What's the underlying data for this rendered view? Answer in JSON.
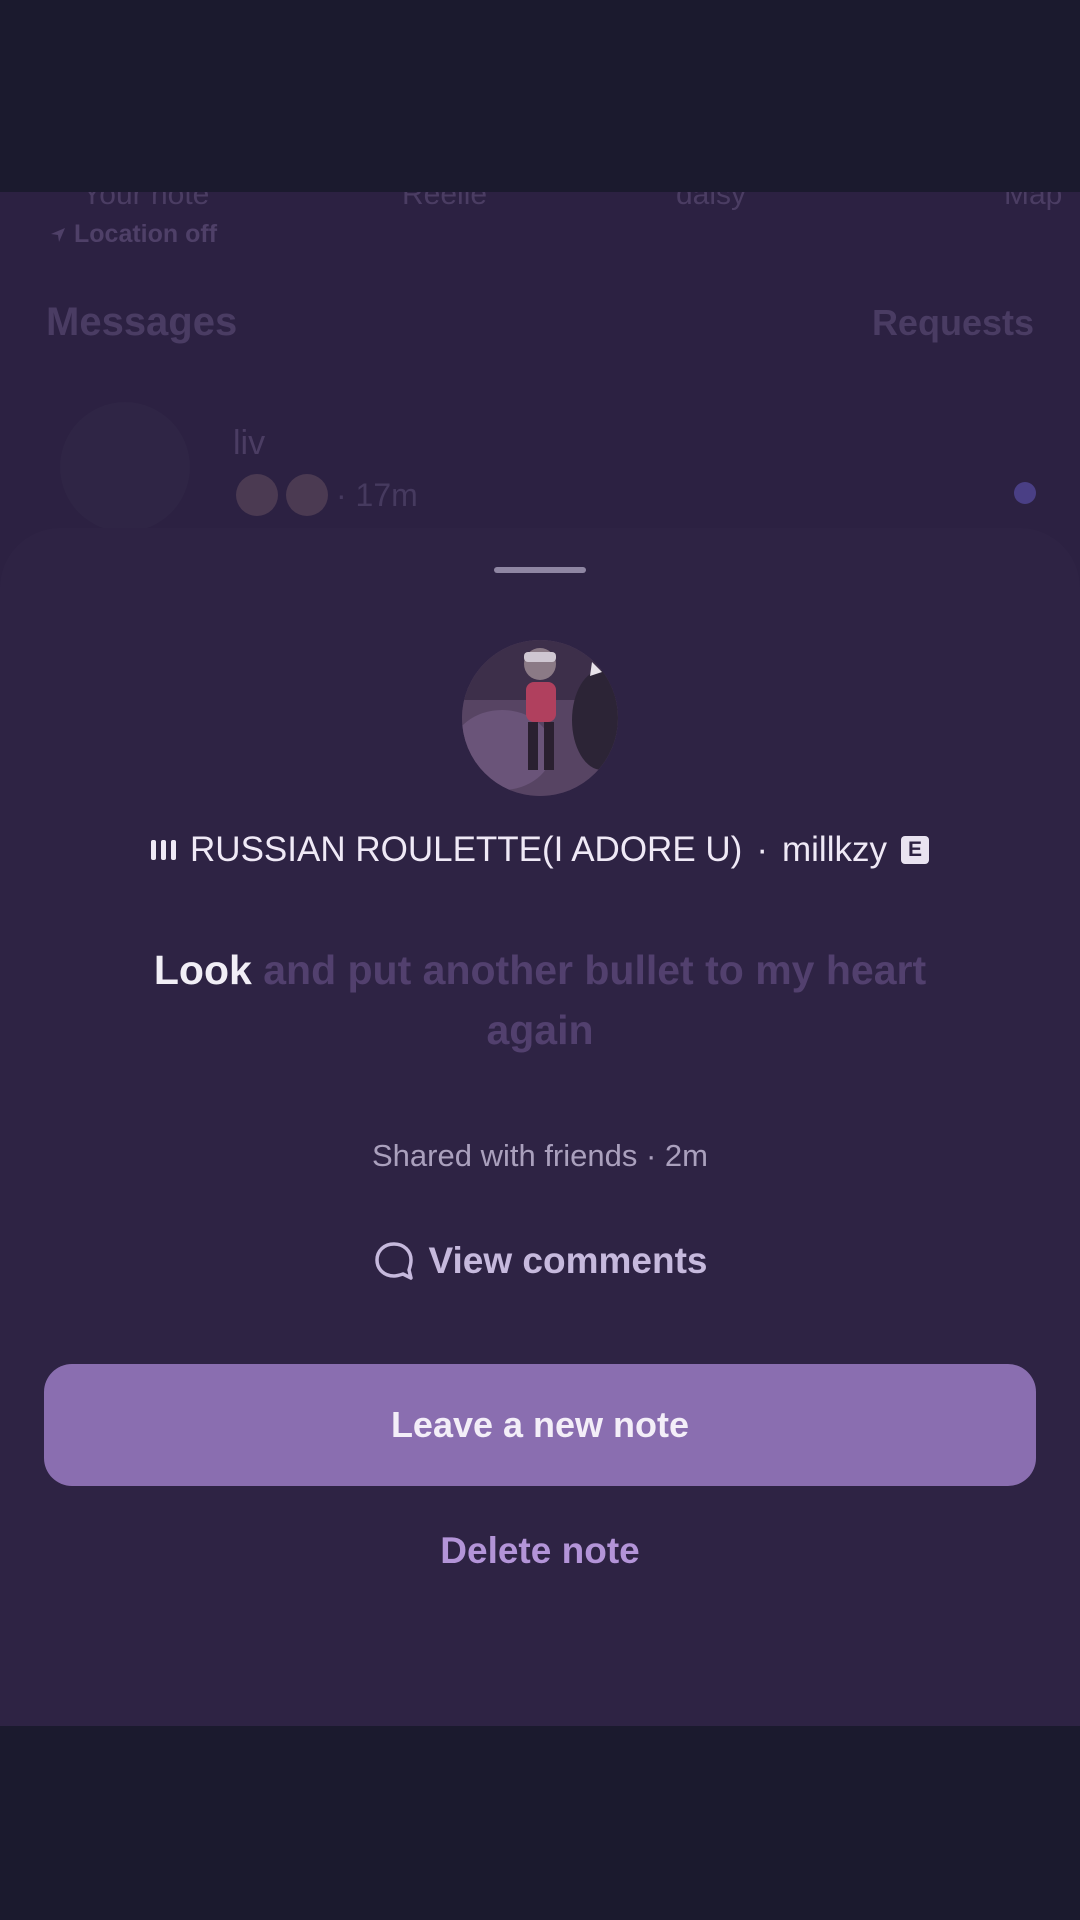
{
  "background": {
    "notes_row": [
      "Your note",
      "Reelle",
      "daisy",
      "Map"
    ],
    "location_text": "Location off",
    "messages_title": "Messages",
    "requests_label": "Requests",
    "chat": {
      "name": "liv",
      "emojis": [
        "neutral-face-emoji",
        "neutral-face-emoji"
      ],
      "time": "· 17m",
      "unread": true
    }
  },
  "sheet": {
    "music": {
      "title": "RUSSIAN ROULETTE(I ADORE U)",
      "separator": "·",
      "artist": "millkzy",
      "explicit_badge": "E"
    },
    "lyrics": {
      "current_word": "Look",
      "rest": "and put another bullet to my heart again"
    },
    "shared_text": "Shared with friends · 2m",
    "view_comments_label": "View comments",
    "primary_button_label": "Leave a new note",
    "delete_label": "Delete note"
  },
  "colors": {
    "sheet_bg": "#2e2344",
    "primary_button": "#8a6eb0",
    "delete_text": "#b394d8",
    "lyric_dim": "#52406e"
  }
}
